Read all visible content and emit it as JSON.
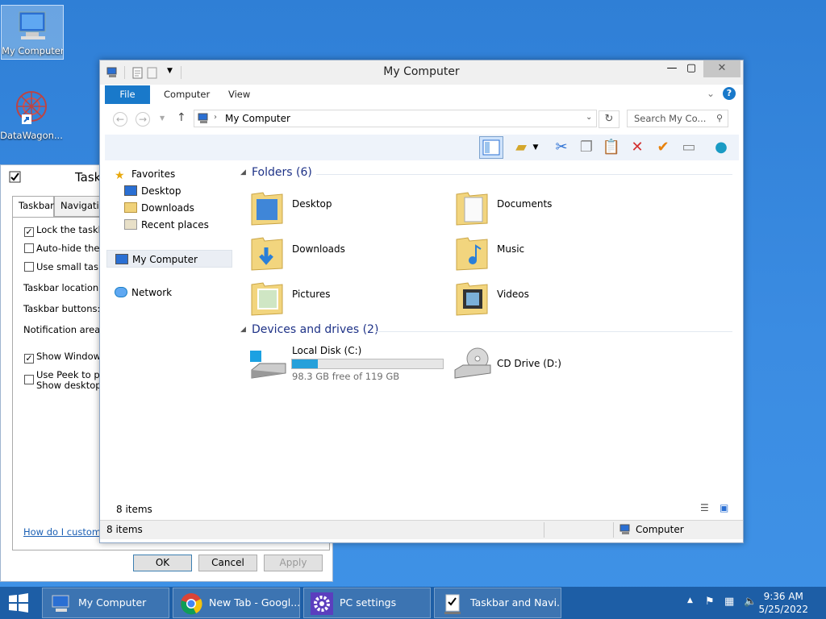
{
  "desktop": {
    "icons": [
      {
        "label": "My Computer"
      },
      {
        "label": "DataWagon..."
      }
    ]
  },
  "taskbar_dialog": {
    "title": "Task",
    "tabs": [
      "Taskbar",
      "Navigation"
    ],
    "options": [
      {
        "label": "Lock the taskbar",
        "checked": true
      },
      {
        "label": "Auto-hide the ta",
        "checked": false
      },
      {
        "label": "Use small taskba",
        "checked": false
      }
    ],
    "fields": [
      "Taskbar location on",
      "Taskbar buttons:",
      "Notification area:"
    ],
    "options2": [
      {
        "label": "Show Windows S",
        "checked": true
      },
      {
        "label": "Use Peek to prev",
        "checked": false
      }
    ],
    "peek_line2": "Show desktop bu",
    "link": "How do I customize",
    "buttons": {
      "ok": "OK",
      "cancel": "Cancel",
      "apply": "Apply"
    }
  },
  "explorer": {
    "title": "My Computer",
    "ribbon_tabs": [
      "File",
      "Computer",
      "View"
    ],
    "address": "My Computer",
    "search_placeholder": "Search My Co...",
    "nav": {
      "favorites": "Favorites",
      "fav_items": [
        "Desktop",
        "Downloads",
        "Recent places"
      ],
      "computer": "My Computer",
      "network": "Network"
    },
    "folders_header": "Folders (6)",
    "folders": [
      "Desktop",
      "Documents",
      "Downloads",
      "Music",
      "Pictures",
      "Videos"
    ],
    "devices_header": "Devices and drives (2)",
    "drives": [
      {
        "name": "Local Disk (C:)",
        "free": "98.3 GB free of 119 GB",
        "used_fraction": 0.17
      },
      {
        "name": "CD Drive (D:)"
      }
    ],
    "items_count": "8 items",
    "status_items": "8 items",
    "status_location": "Computer"
  },
  "taskbar": {
    "buttons": [
      "My Computer",
      "New Tab - Googl...",
      "PC settings",
      "Taskbar and Navi..."
    ],
    "time": "9:36 AM",
    "date": "5/25/2022"
  },
  "colors": {
    "accent": "#1979ca",
    "taskbar": "#1d5ea6",
    "section": "#1e3287"
  }
}
